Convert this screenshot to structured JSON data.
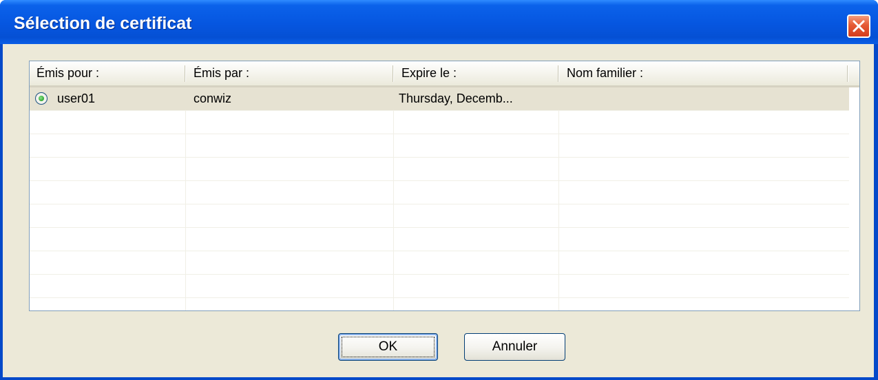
{
  "window": {
    "title": "Sélection de certificat"
  },
  "columns": [
    {
      "label": "Émis pour :"
    },
    {
      "label": "Émis par :"
    },
    {
      "label": "Expire le :"
    },
    {
      "label": "Nom familier :"
    }
  ],
  "rows": [
    {
      "issued_to": "user01",
      "issued_by": "conwiz",
      "expires": "Thursday, Decemb...",
      "friendly_name": "",
      "selected": true
    }
  ],
  "buttons": {
    "ok_label": "OK",
    "cancel_label": "Annuler"
  },
  "colors": {
    "titlebar": "#0656e0",
    "dialog_background": "#ece9d8",
    "close_button": "#e55a34",
    "selected_row": "#e6e2d2"
  },
  "icons": {
    "close": "close-icon",
    "radio": "radio-selected-icon"
  }
}
